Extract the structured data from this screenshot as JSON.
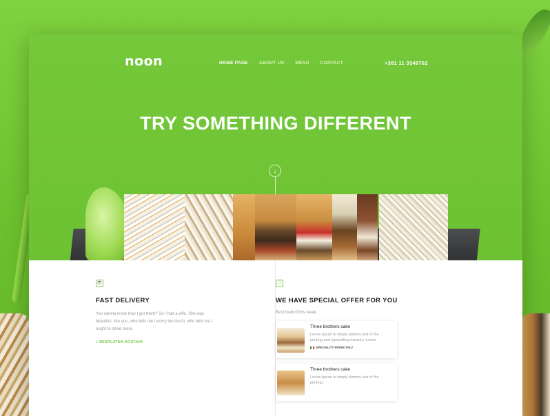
{
  "brand": {
    "logo": "noon"
  },
  "nav": {
    "items": [
      {
        "label": "HOME PAGE",
        "active": true
      },
      {
        "label": "ABOUT US",
        "active": false
      },
      {
        "label": "MENU",
        "active": false
      },
      {
        "label": "CONTACT",
        "active": false
      }
    ],
    "phone": "+381 11 3349762"
  },
  "hero": {
    "headline": "TRY SOMETHING DIFFERENT",
    "scroll_icon": "arrow-down-icon"
  },
  "features": {
    "left": {
      "icon": "coffee-cup-icon",
      "title": "FAST DELIVERY",
      "text": "You wanna know how I got them? So I had a wife. She was beautiful, like you, who tells me I worry too much, who tells me I ought to smile more.",
      "link": "+ BESPLATNA DOSTAVA"
    },
    "right": {
      "icon": "box-icon",
      "title": "WE HAVE SPECIAL OFFER FOR YOU",
      "subtitle": "Best food of this week",
      "cards": [
        {
          "title": "Three brothers cake",
          "desc": "Lorem ipsum is simply dummy text of the printing and typesetting industry. Lorem",
          "tag": "SPECIALITY FROM ITALY"
        },
        {
          "title": "Three brothers cake",
          "desc": "Lorem ipsum is simply dummy text of the printing",
          "tag": ""
        }
      ]
    }
  },
  "colors": {
    "accent": "#7ec84a",
    "hero": "#6dc233",
    "flag": [
      "#2f9e3f",
      "#ffffff",
      "#d83a2e"
    ]
  }
}
